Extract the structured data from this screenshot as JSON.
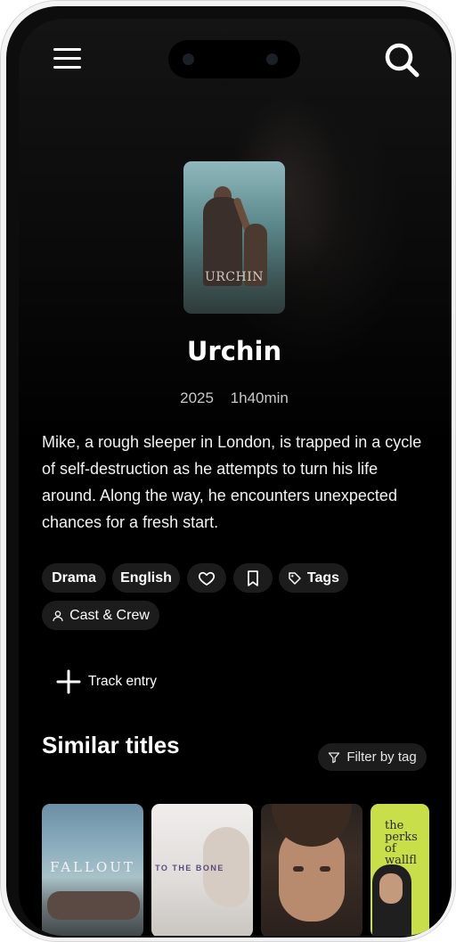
{
  "movie": {
    "title": "Urchin",
    "year": "2025",
    "runtime": "1h40min",
    "poster_text": "URCHIN",
    "synopsis": "Mike, a rough sleeper in London, is trapped in a cycle of self-destruction as he attempts to turn his life around. Along the way, he encounters unexpected chances for a fresh start."
  },
  "chips": {
    "genre": "Drama",
    "language": "English",
    "tags": "Tags",
    "cast_crew": "Cast & Crew"
  },
  "actions": {
    "track_entry": "Track entry"
  },
  "similar": {
    "heading": "Similar titles",
    "filter_label": "Filter by tag",
    "items": [
      {
        "poster_text": "FALLOUT"
      },
      {
        "poster_text": "TO THE BONE"
      },
      {
        "poster_text": ""
      },
      {
        "poster_text": "the perks of wallfl"
      }
    ]
  },
  "icons": {
    "menu": "menu-icon",
    "search": "search-icon",
    "like": "heart-icon",
    "bookmark": "bookmark-icon",
    "tag": "tag-icon",
    "person": "person-icon",
    "plus": "plus-icon",
    "filter": "filter-icon"
  },
  "colors": {
    "background": "#000000",
    "chip_background": "#1c1c1c",
    "text": "#ffffff",
    "muted_text": "#c8c8c8"
  }
}
